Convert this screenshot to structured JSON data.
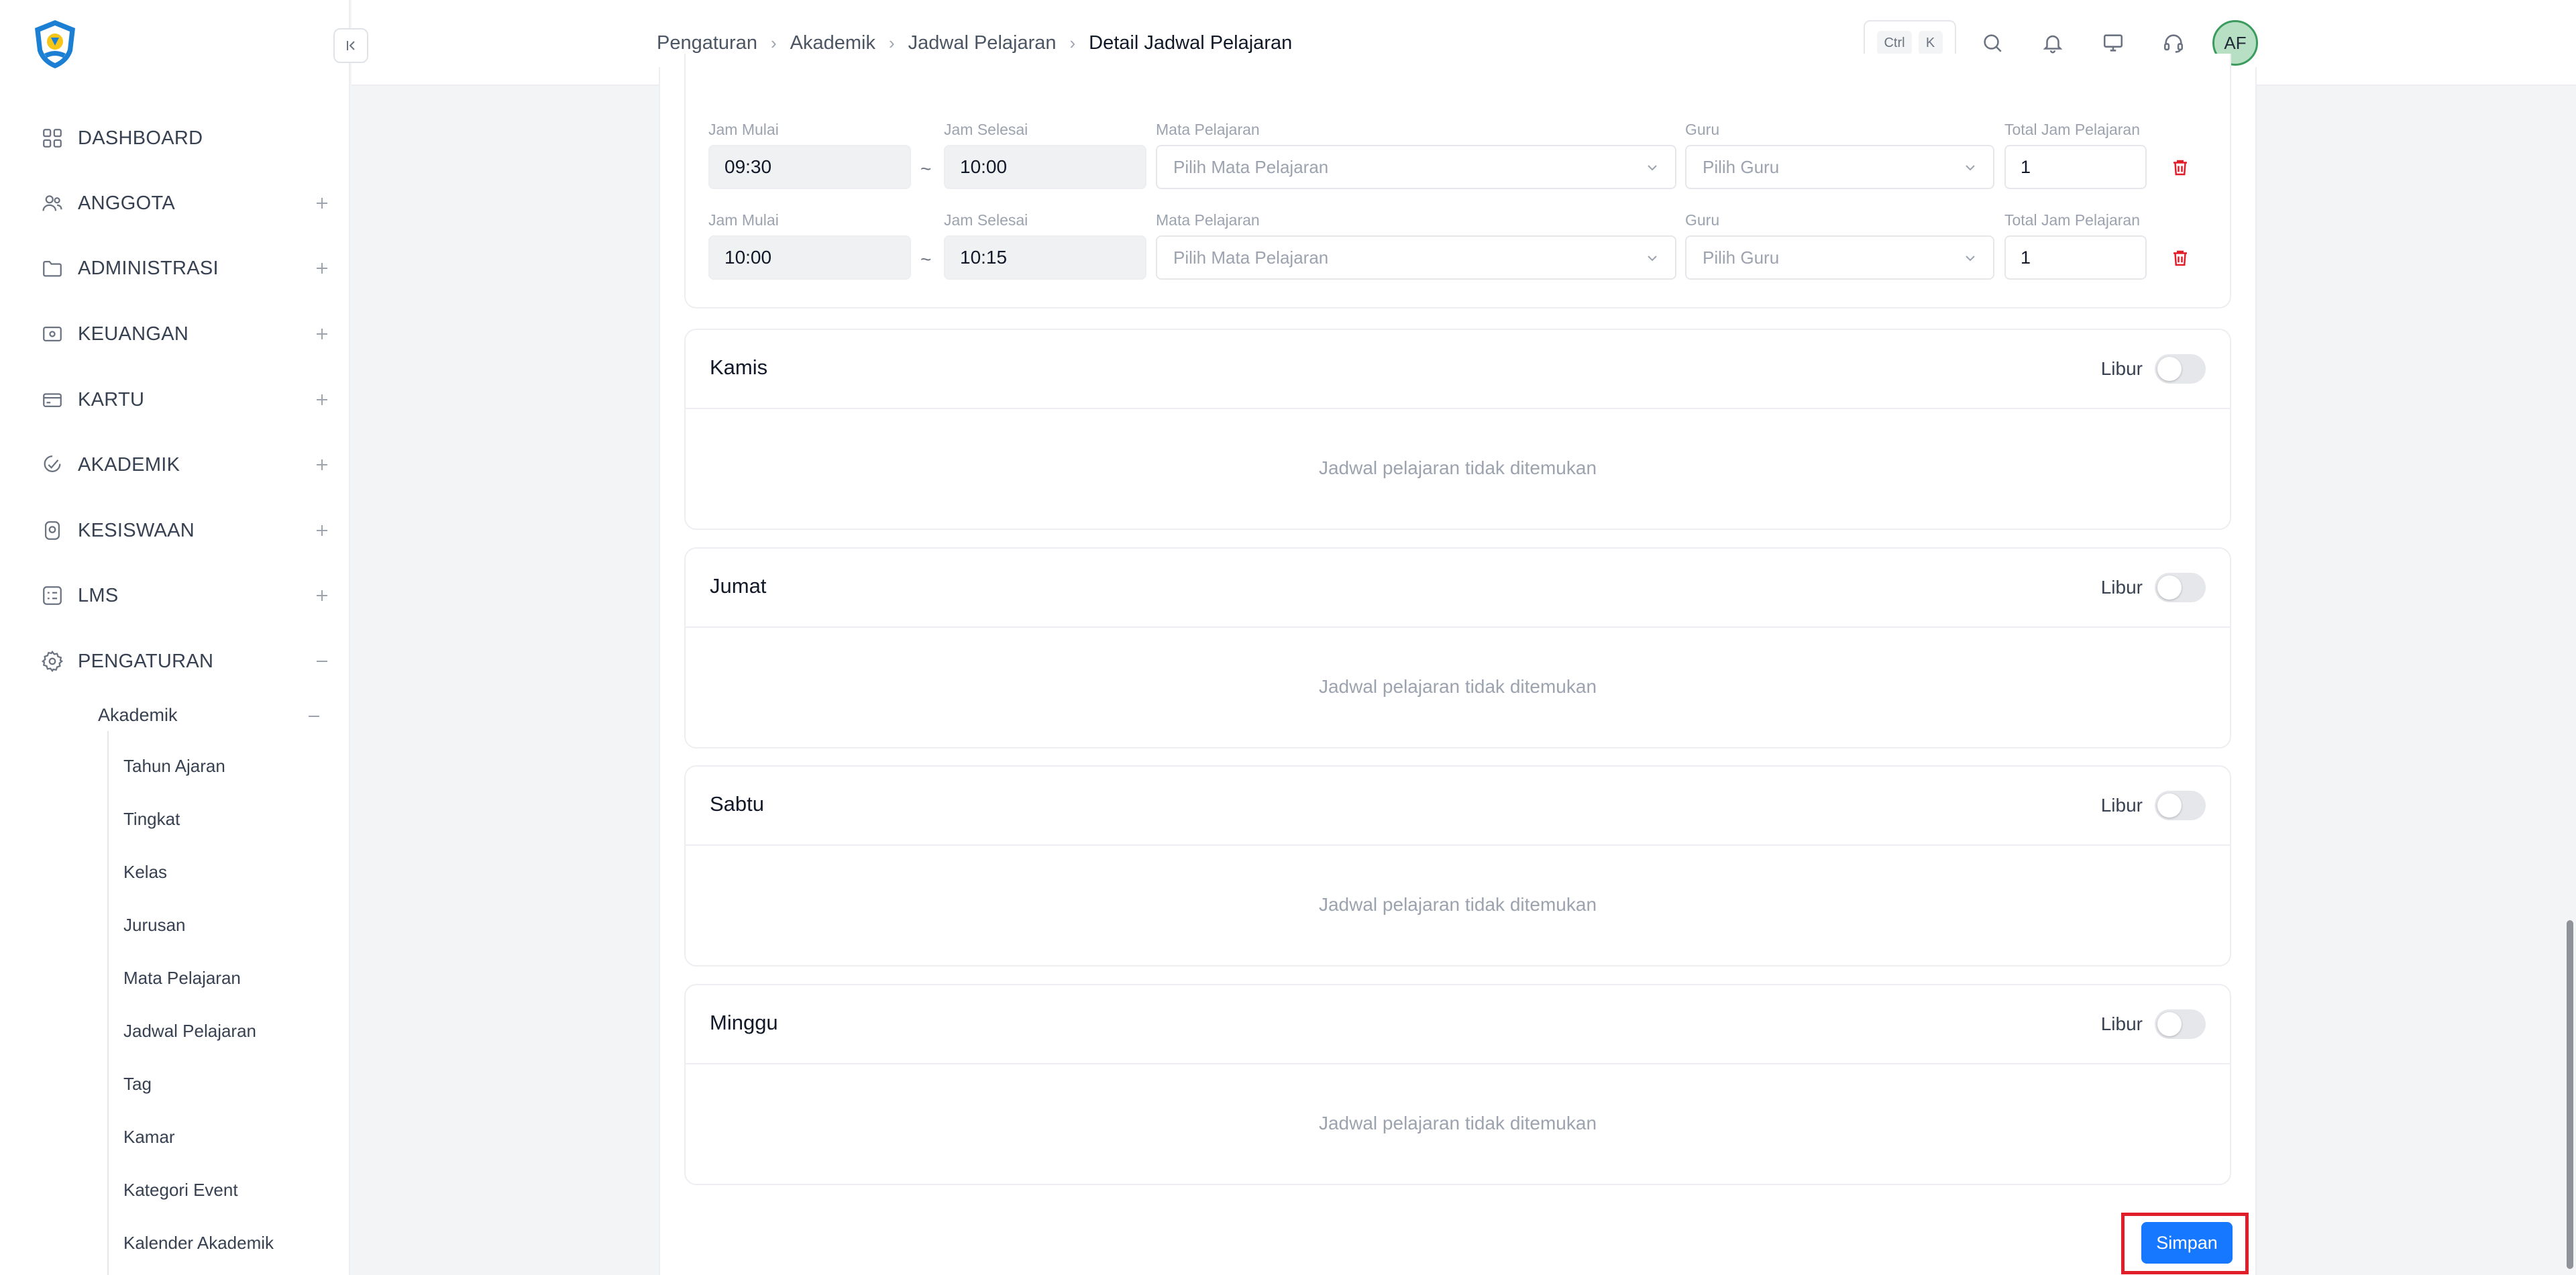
{
  "breadcrumb": {
    "items": [
      "Pengaturan",
      "Akademik",
      "Jadwal Pelajaran"
    ],
    "current": "Detail Jadwal Pelajaran"
  },
  "topbar": {
    "shortcut_keys": [
      "Ctrl",
      "K"
    ],
    "icons": [
      "search-icon",
      "bell-icon",
      "monitor-icon",
      "headset-icon"
    ],
    "avatar_initials": "AF"
  },
  "sidebar": {
    "menu": [
      {
        "label": "DASHBOARD",
        "icon": "grid-icon"
      },
      {
        "label": "ANGGOTA",
        "icon": "users-icon"
      },
      {
        "label": "ADMINISTRASI",
        "icon": "folder-icon"
      },
      {
        "label": "KEUANGAN",
        "icon": "wallet-icon"
      },
      {
        "label": "KARTU",
        "icon": "card-icon"
      },
      {
        "label": "AKADEMIK",
        "icon": "academic-icon"
      },
      {
        "label": "KESISWAAN",
        "icon": "student-icon"
      },
      {
        "label": "LMS",
        "icon": "list-icon"
      },
      {
        "label": "PENGATURAN",
        "icon": "gear-icon"
      }
    ],
    "submenu_title": "Akademik",
    "submenu": [
      "Tahun Ajaran",
      "Tingkat",
      "Kelas",
      "Jurusan",
      "Mata Pelajaran",
      "Jadwal Pelajaran",
      "Tag",
      "Kamar",
      "Kategori Event",
      "Kalender Akademik"
    ]
  },
  "schedule_labels": {
    "start": "Jam Mulai",
    "end": "Jam Selesai",
    "subject": "Mata Pelajaran",
    "teacher": "Guru",
    "total": "Total Jam Pelajaran",
    "separator": "~"
  },
  "schedule_rows": [
    {
      "start": "09:30",
      "end": "10:00",
      "subject_placeholder": "Pilih Mata Pelajaran",
      "teacher_placeholder": "Pilih Guru",
      "total": "1"
    },
    {
      "start": "10:00",
      "end": "10:15",
      "subject_placeholder": "Pilih Mata Pelajaran",
      "teacher_placeholder": "Pilih Guru",
      "total": "1"
    }
  ],
  "days": [
    {
      "name": "Kamis",
      "libur_label": "Libur",
      "empty_text": "Jadwal pelajaran tidak ditemukan",
      "libur": false
    },
    {
      "name": "Jumat",
      "libur_label": "Libur",
      "empty_text": "Jadwal pelajaran tidak ditemukan",
      "libur": false
    },
    {
      "name": "Sabtu",
      "libur_label": "Libur",
      "empty_text": "Jadwal pelajaran tidak ditemukan",
      "libur": false
    },
    {
      "name": "Minggu",
      "libur_label": "Libur",
      "empty_text": "Jadwal pelajaran tidak ditemukan",
      "libur": false
    }
  ],
  "actions": {
    "save_label": "Simpan"
  },
  "colors": {
    "primary": "#1677ff",
    "danger": "#e11d2a",
    "avatar_bg": "#b7dfc4"
  }
}
